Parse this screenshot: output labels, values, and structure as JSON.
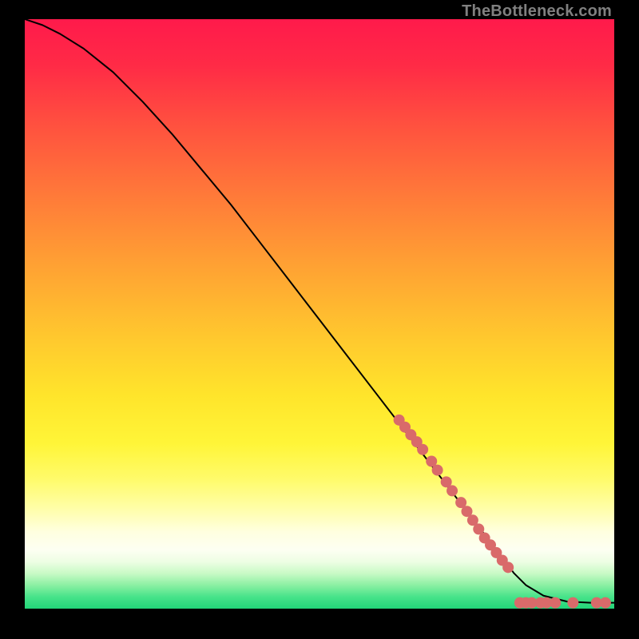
{
  "attribution": "TheBottleneck.com",
  "colors": {
    "curve": "#000000",
    "marker_fill": "#d96a6a",
    "marker_stroke": "#b14e4e",
    "frame_bg": "#000000"
  },
  "chart_data": {
    "type": "line",
    "title": "",
    "xlabel": "",
    "ylabel": "",
    "xlim": [
      0,
      100
    ],
    "ylim": [
      0,
      100
    ],
    "series": [
      {
        "name": "curve",
        "x": [
          0,
          3,
          6,
          10,
          15,
          20,
          25,
          30,
          35,
          40,
          45,
          50,
          55,
          60,
          65,
          70,
          75,
          80,
          83,
          85,
          88,
          92,
          96,
          100
        ],
        "y": [
          100,
          99,
          97.5,
          95,
          91,
          86,
          80.5,
          74.5,
          68.5,
          62,
          55.5,
          49,
          42.5,
          36,
          29.5,
          23,
          16.5,
          10,
          6,
          4,
          2.2,
          1.2,
          1.0,
          1.0
        ]
      }
    ],
    "markers": [
      {
        "x": 63.5,
        "y": 32.0
      },
      {
        "x": 64.5,
        "y": 30.8
      },
      {
        "x": 65.5,
        "y": 29.5
      },
      {
        "x": 66.5,
        "y": 28.3
      },
      {
        "x": 67.5,
        "y": 27.0
      },
      {
        "x": 69.0,
        "y": 25.0
      },
      {
        "x": 70.0,
        "y": 23.5
      },
      {
        "x": 71.5,
        "y": 21.5
      },
      {
        "x": 72.5,
        "y": 20.0
      },
      {
        "x": 74.0,
        "y": 18.0
      },
      {
        "x": 75.0,
        "y": 16.5
      },
      {
        "x": 76.0,
        "y": 15.0
      },
      {
        "x": 77.0,
        "y": 13.5
      },
      {
        "x": 78.0,
        "y": 12.0
      },
      {
        "x": 79.0,
        "y": 10.8
      },
      {
        "x": 80.0,
        "y": 9.5
      },
      {
        "x": 81.0,
        "y": 8.2
      },
      {
        "x": 82.0,
        "y": 7.0
      },
      {
        "x": 84.0,
        "y": 1.0
      },
      {
        "x": 85.0,
        "y": 1.0
      },
      {
        "x": 86.0,
        "y": 1.0
      },
      {
        "x": 87.5,
        "y": 1.0
      },
      {
        "x": 88.5,
        "y": 1.0
      },
      {
        "x": 90.0,
        "y": 1.0
      },
      {
        "x": 93.0,
        "y": 1.0
      },
      {
        "x": 97.0,
        "y": 1.0
      },
      {
        "x": 98.5,
        "y": 1.0
      }
    ]
  }
}
